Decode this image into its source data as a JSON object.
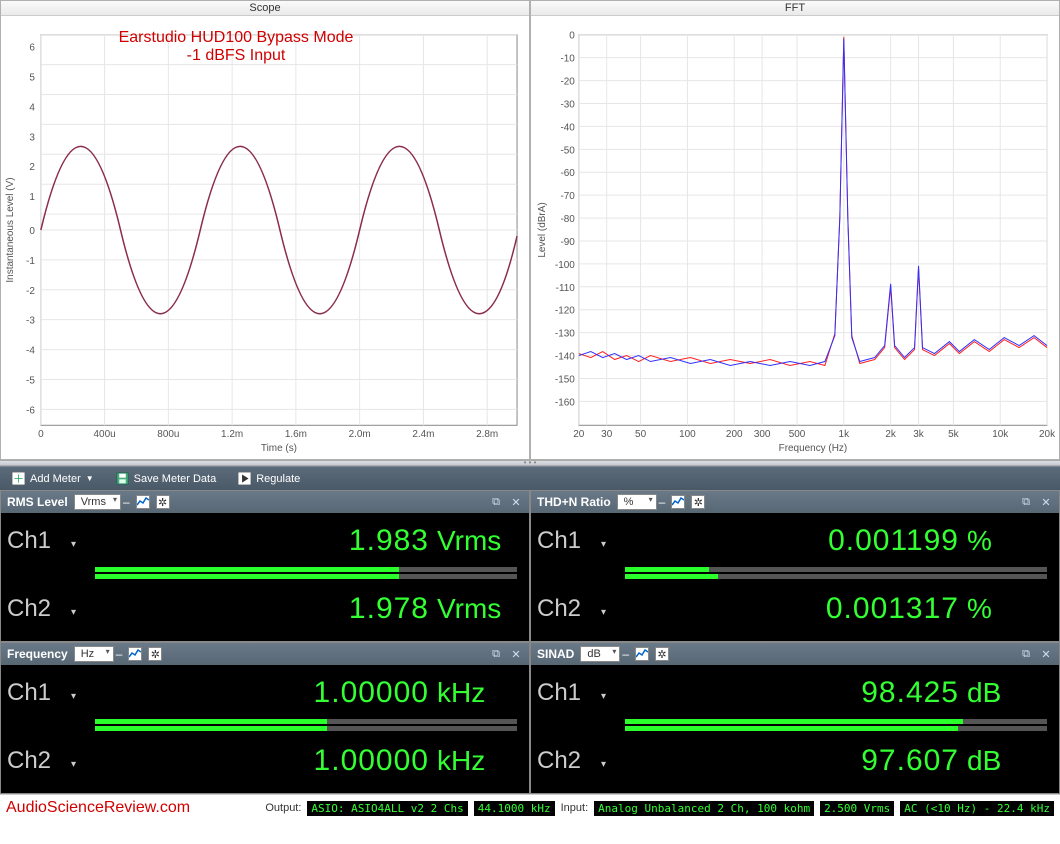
{
  "charts": {
    "scope": {
      "title": "Scope",
      "xlabel": "Time (s)",
      "ylabel": "Instantaneous Level (V)"
    },
    "fft": {
      "title": "FFT",
      "xlabel": "Frequency (Hz)",
      "ylabel": "Level (dBrA)"
    },
    "annotation_line1": "Earstudio HUD100 Bypass Mode",
    "annotation_line2": "-1 dBFS Input"
  },
  "toolbar": {
    "add_meter": "Add Meter",
    "save_meter": "Save Meter Data",
    "regulate": "Regulate"
  },
  "meters": [
    {
      "title": "RMS Level",
      "unit_sel": "Vrms",
      "ch1_val": "1.983",
      "ch1_unit": "Vrms",
      "ch2_val": "1.978",
      "ch2_unit": "Vrms",
      "bar1": 72,
      "bar2": 72
    },
    {
      "title": "THD+N Ratio",
      "unit_sel": "%",
      "ch1_val": "0.001199",
      "ch1_unit": "%",
      "ch2_val": "0.001317",
      "ch2_unit": "%",
      "bar1": 20,
      "bar2": 22
    },
    {
      "title": "Frequency",
      "unit_sel": "Hz",
      "ch1_val": "1.00000",
      "ch1_unit": "kHz",
      "ch2_val": "1.00000",
      "ch2_unit": "kHz",
      "bar1": 55,
      "bar2": 55
    },
    {
      "title": "SINAD",
      "unit_sel": "dB",
      "ch1_val": "98.425",
      "ch1_unit": "dB",
      "ch2_val": "97.607",
      "ch2_unit": "dB",
      "bar1": 80,
      "bar2": 79
    }
  ],
  "labels": {
    "ch1": "Ch1",
    "ch2": "Ch2"
  },
  "status": {
    "brand": "AudioScienceReview.com",
    "output_label": "Output:",
    "output_dev": "ASIO: ASIO4ALL v2 2 Chs",
    "output_rate": "44.1000 kHz",
    "input_label": "Input:",
    "input_dev": "Analog Unbalanced 2 Ch, 100 kohm",
    "input_lvl": "2.500 Vrms",
    "input_bw": "AC (<10 Hz) - 22.4 kHz"
  },
  "chart_data": [
    {
      "type": "line",
      "title": "Scope",
      "xlabel": "Time (s)",
      "ylabel": "Instantaneous Level (V)",
      "xlim": [
        0,
        0.003
      ],
      "ylim": [
        -6.5,
        6.5
      ],
      "xticks": [
        0,
        0.0004,
        0.0008,
        0.0012,
        0.0016,
        0.002,
        0.0024,
        0.0028
      ],
      "xticklabels": [
        "0",
        "400u",
        "800u",
        "1.2m",
        "1.6m",
        "2.0m",
        "2.4m",
        "2.8m"
      ],
      "yticks": [
        -6,
        -5,
        -4,
        -3,
        -2,
        -1,
        0,
        1,
        2,
        3,
        4,
        5,
        6
      ],
      "description": "Sine wave, peak amplitude ≈ 2.8 V, frequency ≈ 1 kHz (period ≈ 1 ms), starting at 0 V rising",
      "series": [
        {
          "name": "Ch",
          "color": "#8a2c4c",
          "amplitude": 2.8,
          "frequency_hz": 1000,
          "phase_deg": 0
        }
      ]
    },
    {
      "type": "line",
      "title": "FFT",
      "xlabel": "Frequency (Hz)",
      "ylabel": "Level (dBrA)",
      "xscale": "log",
      "xlim": [
        20,
        20000
      ],
      "ylim": [
        -165,
        5
      ],
      "xticks": [
        20,
        30,
        50,
        100,
        200,
        300,
        500,
        1000,
        2000,
        3000,
        5000,
        10000,
        20000
      ],
      "xticklabels": [
        "20",
        "30",
        "50",
        "100",
        "200",
        "300",
        "500",
        "1k",
        "2k",
        "3k",
        "5k",
        "10k",
        "20k"
      ],
      "yticks": [
        0,
        -10,
        -20,
        -30,
        -40,
        -50,
        -60,
        -70,
        -80,
        -90,
        -100,
        -110,
        -120,
        -130,
        -140,
        -150,
        -160
      ],
      "noise_floor_approx_db": -142,
      "series": [
        {
          "name": "Ch1",
          "color": "#3030ff",
          "peaks": [
            {
              "freq_hz": 1000,
              "level_db": -1
            },
            {
              "freq_hz": 2000,
              "level_db": -110
            },
            {
              "freq_hz": 3000,
              "level_db": -102
            },
            {
              "freq_hz": 4000,
              "level_db": -126
            },
            {
              "freq_hz": 5000,
              "level_db": -120
            }
          ]
        },
        {
          "name": "Ch2",
          "color": "#ff2020",
          "peaks": [
            {
              "freq_hz": 1000,
              "level_db": -1
            },
            {
              "freq_hz": 2000,
              "level_db": -112
            },
            {
              "freq_hz": 3000,
              "level_db": -104
            },
            {
              "freq_hz": 4000,
              "level_db": -128
            },
            {
              "freq_hz": 5000,
              "level_db": -122
            }
          ]
        }
      ]
    }
  ]
}
